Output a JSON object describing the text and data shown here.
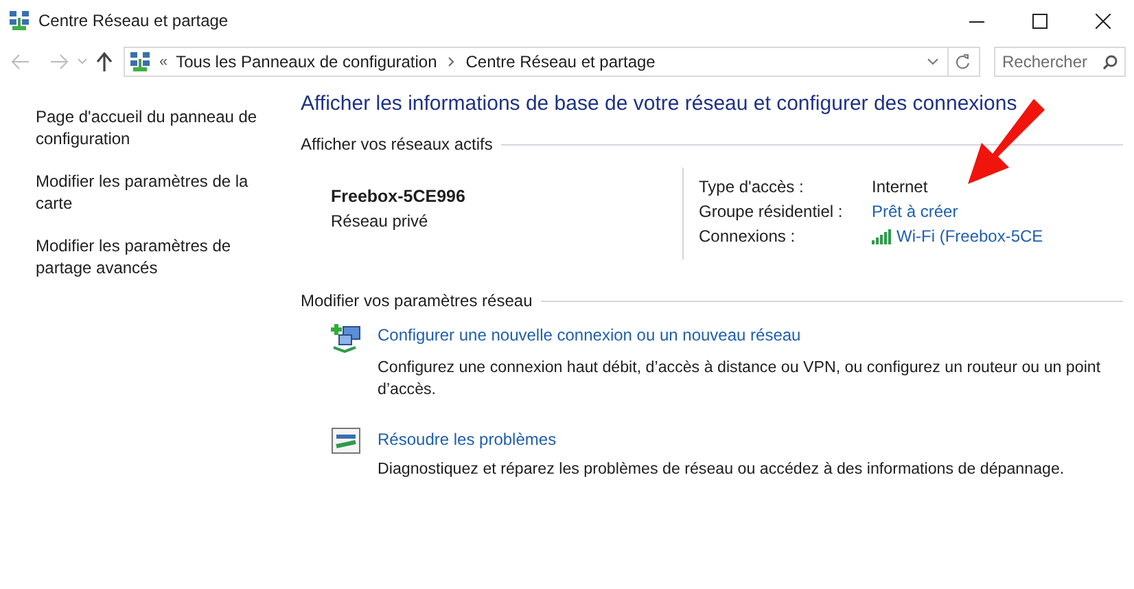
{
  "window": {
    "title": "Centre Réseau et partage"
  },
  "address_bar": {
    "overflow": "«",
    "path": [
      "Tous les Panneaux de configuration",
      "Centre Réseau et partage"
    ]
  },
  "search": {
    "placeholder": "Rechercher"
  },
  "sidebar": {
    "items": [
      {
        "label": "Page d'accueil du panneau de configuration"
      },
      {
        "label": "Modifier les paramètres de la carte"
      },
      {
        "label": "Modifier les paramètres de partage avancés"
      }
    ]
  },
  "main": {
    "heading": "Afficher les informations de base de votre réseau et configurer des connexions",
    "active_networks": {
      "title": "Afficher vos réseaux actifs",
      "network": {
        "name": "Freebox-5CE996",
        "profile": "Réseau privé"
      },
      "properties": [
        {
          "label": "Type d'accès :",
          "value": "Internet",
          "kind": "text"
        },
        {
          "label": "Groupe résidentiel :",
          "value": "Prêt à créer",
          "kind": "link"
        },
        {
          "label": "Connexions :",
          "value": "Wi-Fi (Freebox-5CE",
          "kind": "wifi"
        }
      ]
    },
    "settings": {
      "title": "Modifier vos paramètres réseau",
      "tasks": [
        {
          "kind": "new-connection",
          "link": "Configurer une nouvelle connexion ou un nouveau réseau",
          "description": "Configurez une connexion haut débit, d’accès à distance ou VPN, ou configurez un routeur ou un point d’accès."
        },
        {
          "kind": "troubleshoot",
          "link": "Résoudre les problèmes",
          "description": "Diagnostiquez et réparez les problèmes de réseau ou accédez à des informations de dépannage."
        }
      ]
    }
  }
}
